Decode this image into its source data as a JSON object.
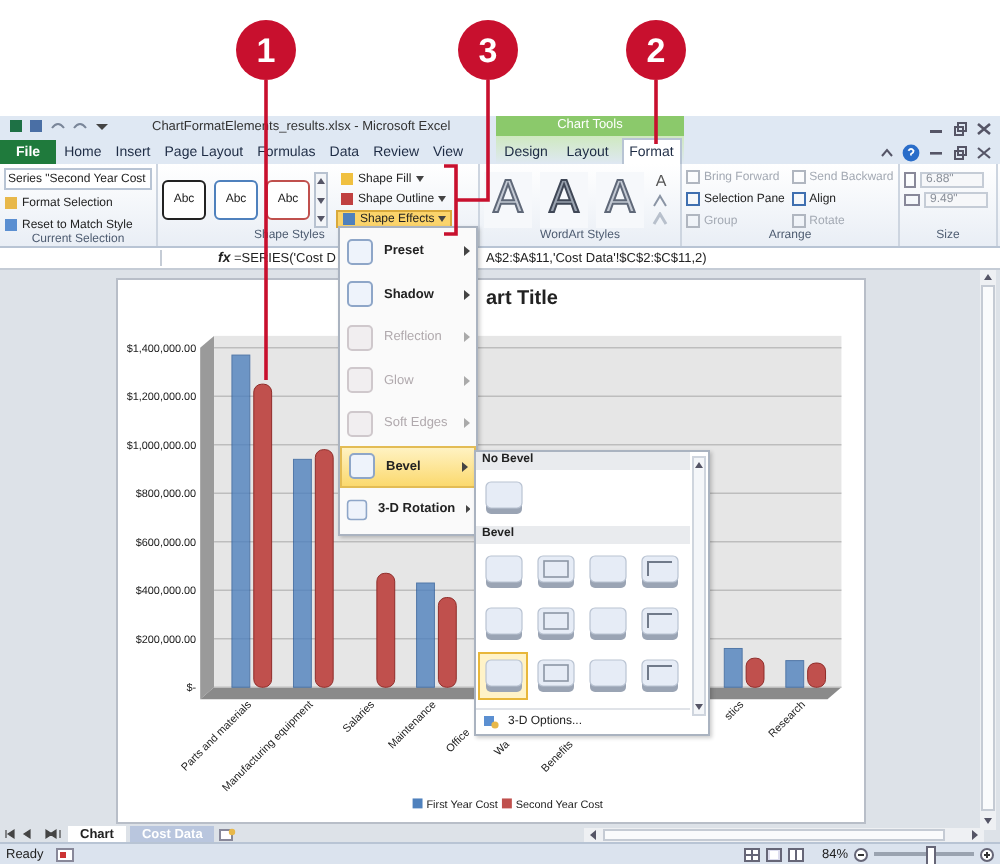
{
  "callouts": [
    {
      "number": "1"
    },
    {
      "number": "3"
    },
    {
      "number": "2"
    }
  ],
  "window": {
    "title": "ChartFormatElements_results.xlsx - Microsoft Excel",
    "context_title": "Chart Tools"
  },
  "tabs": [
    {
      "label": "File",
      "kind": "file",
      "selected": false
    },
    {
      "label": "Home",
      "kind": "normal",
      "selected": false
    },
    {
      "label": "Insert",
      "kind": "normal",
      "selected": false
    },
    {
      "label": "Page Layout",
      "kind": "normal",
      "selected": false
    },
    {
      "label": "Formulas",
      "kind": "normal",
      "selected": false
    },
    {
      "label": "Data",
      "kind": "normal",
      "selected": false
    },
    {
      "label": "Review",
      "kind": "normal",
      "selected": false
    },
    {
      "label": "View",
      "kind": "normal",
      "selected": false
    },
    {
      "label": "Design",
      "kind": "context",
      "selected": false
    },
    {
      "label": "Layout",
      "kind": "context",
      "selected": false
    },
    {
      "label": "Format",
      "kind": "context",
      "selected": true
    }
  ],
  "ribbon": {
    "current_selection": {
      "dropdown": "Series \"Second Year Cost",
      "buttons": [
        "Format Selection",
        "Reset to Match Style"
      ],
      "label": "Current Selection"
    },
    "shape_styles": {
      "previews": [
        {
          "text": "Abc",
          "color": "#222222"
        },
        {
          "text": "Abc",
          "color": "#4f81bd"
        },
        {
          "text": "Abc",
          "color": "#c0504d"
        }
      ],
      "commands": [
        {
          "label": "Shape Fill",
          "expanded": false
        },
        {
          "label": "Shape Outline",
          "expanded": false
        },
        {
          "label": "Shape Effects",
          "expanded": true
        }
      ],
      "label": "Shape Styles"
    },
    "wordart_styles": {
      "previews": [
        "A",
        "A",
        "A"
      ],
      "text_fill": "A",
      "label": "WordArt Styles"
    },
    "arrange": {
      "commands": [
        {
          "label": "Bring Forward",
          "disabled": true
        },
        {
          "label": "Send Backward",
          "disabled": true
        },
        {
          "label": "Selection Pane",
          "disabled": false
        },
        {
          "label": "Align",
          "disabled": false
        },
        {
          "label": "Group",
          "disabled": true
        },
        {
          "label": "Rotate",
          "disabled": true
        }
      ],
      "label": "Arrange"
    },
    "size": {
      "height": "6.88\"",
      "width": "9.49\"",
      "label": "Size"
    }
  },
  "formula_bar": {
    "fx": "fx",
    "formula_start": "=SERIES('Cost D",
    "formula_end": "A$2:$A$11,'Cost Data'!$C$2:$C$11,2)"
  },
  "chart": {
    "title": "art Title",
    "partly_hidden_labels": [
      "Office",
      "Wa",
      "Benefits"
    ],
    "chart_data": {
      "type": "bar",
      "categories": [
        "Parts and materials",
        "Manufacturing equipment",
        "Salaries",
        "Maintenance",
        null,
        null,
        null,
        null,
        "stics",
        "Research"
      ],
      "series": [
        {
          "name": "First Year Cost",
          "color": "#4f81bd",
          "values": [
            1370000,
            940000,
            null,
            430000,
            null,
            null,
            null,
            null,
            160000,
            110000
          ]
        },
        {
          "name": "Second Year Cost",
          "color": "#c0504d",
          "values": [
            1250000,
            980000,
            470000,
            370000,
            null,
            null,
            null,
            null,
            120000,
            100000
          ]
        }
      ],
      "grid": true,
      "legend": true,
      "ylim": [
        0,
        1400000
      ],
      "yticks": [
        {
          "value": 0,
          "label": "$-"
        },
        {
          "value": 200000,
          "label": "$200,000.00"
        },
        {
          "value": 400000,
          "label": "$400,000.00"
        },
        {
          "value": 600000,
          "label": "$600,000.00"
        },
        {
          "value": 800000,
          "label": "$800,000.00"
        },
        {
          "value": 1000000,
          "label": "$1,000,000.00"
        },
        {
          "value": 1200000,
          "label": "$1,200,000.00"
        },
        {
          "value": 1400000,
          "label": "$1,400,000.00"
        }
      ]
    }
  },
  "shape_effects_menu": {
    "items": [
      {
        "label": "Preset",
        "disabled": false,
        "selected": false
      },
      {
        "label": "Shadow",
        "disabled": false,
        "selected": false
      },
      {
        "label": "Reflection",
        "disabled": true,
        "selected": false
      },
      {
        "label": "Glow",
        "disabled": true,
        "selected": false
      },
      {
        "label": "Soft Edges",
        "disabled": true,
        "selected": false
      },
      {
        "label": "Bevel",
        "disabled": false,
        "selected": true
      },
      {
        "label": "3-D Rotation",
        "disabled": false,
        "selected": false
      }
    ]
  },
  "bevel_gallery": {
    "sections": [
      {
        "title": "No Bevel",
        "tiles": [
          {
            "selected": false
          }
        ]
      },
      {
        "title": "Bevel",
        "tiles": [
          {
            "selected": false
          },
          {
            "selected": false
          },
          {
            "selected": false
          },
          {
            "selected": false
          },
          {
            "selected": false
          },
          {
            "selected": false
          },
          {
            "selected": false
          },
          {
            "selected": false
          },
          {
            "selected": true
          },
          {
            "selected": false
          },
          {
            "selected": false
          },
          {
            "selected": false
          }
        ]
      }
    ],
    "footer": "3-D Options..."
  },
  "sheet_tabs": [
    {
      "label": "Chart",
      "selected": true
    },
    {
      "label": "Cost Data",
      "selected": false
    }
  ],
  "status_bar": {
    "status": "Ready",
    "zoom": "84%",
    "zoom_slider": {
      "level": 0.55
    }
  }
}
